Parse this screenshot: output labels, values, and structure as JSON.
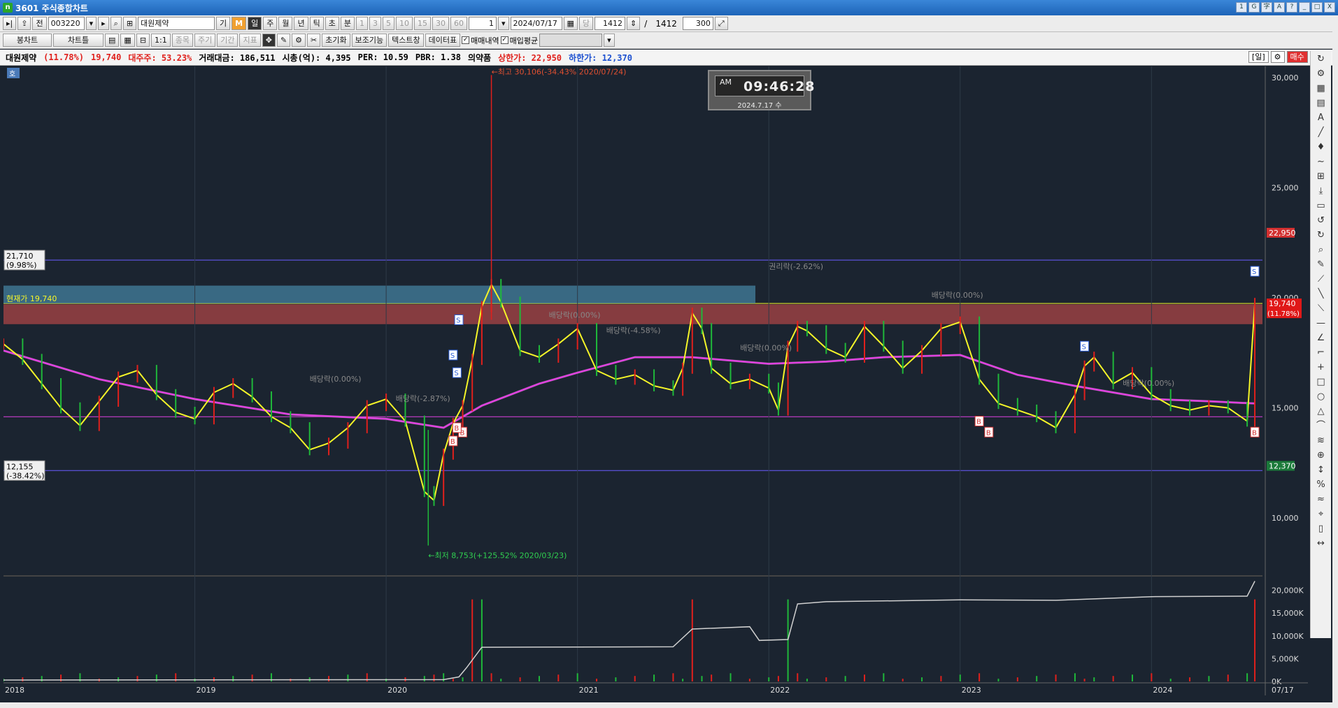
{
  "window": {
    "app_logo": "n",
    "title": "3601 주식종합차트",
    "buttons": [
      "1",
      "G",
      "字",
      "A",
      "?",
      "_",
      "□",
      "X"
    ]
  },
  "toolbar1": {
    "icon_prev": "▸|",
    "btn_jeon": "전",
    "stock_code": "003220",
    "stock_name": "대원제약",
    "btn_gi": "기",
    "btn_m": "M",
    "periods": [
      "일",
      "주",
      "월",
      "년",
      "틱",
      "초",
      "분"
    ],
    "active_period": "일",
    "minute_options": [
      "1",
      "3",
      "5",
      "10",
      "15",
      "30",
      "60"
    ],
    "count_value": "1",
    "date_value": "2024/07/17",
    "btn_dang": "당",
    "view_count": "1412",
    "slash": "/",
    "total_count": "1412",
    "display_count": "300"
  },
  "toolbar2": {
    "chart_type": "봉차트",
    "chart_frame": "차트틀",
    "btn_item": "종목",
    "btn_period": "주기",
    "btn_range": "기간",
    "btn_indicator": "지표",
    "btn_reset": "초기화",
    "btn_aux": "보조기능",
    "btn_text": "텍스트창",
    "btn_data": "데이터표",
    "chk_trade": "매매내역",
    "chk_avg": "매입평균"
  },
  "infobar": {
    "name": "대원제약",
    "change_pct": "(11.78%)",
    "price": "19,740",
    "major_label": "대주주:",
    "major_value": "53.23%",
    "turnover_label": "거래대금:",
    "turnover_value": "186,511",
    "mcap_label": "시총(억):",
    "mcap_value": "4,395",
    "per_label": "PER:",
    "per_value": "10.59",
    "pbr_label": "PBR:",
    "pbr_value": "1.38",
    "sector": "의약품",
    "upper_label": "상한가:",
    "upper_value": "22,950",
    "lower_label": "하한가:",
    "lower_value": "12,370",
    "right_buttons": [
      "[일]",
      "⚙",
      "매수",
      "매도"
    ]
  },
  "clock": {
    "ampm": "AM",
    "time": "09:46:28",
    "date": "2024.7.17 수"
  },
  "colors": {
    "background": "#1b2430",
    "up": "#e0201c",
    "down": "#1fb83a",
    "ma_yellow": "#f5f528",
    "ma_magenta": "#e040e0",
    "ma_gray": "#8a8a8a",
    "volume_line": "#d0d0d0"
  },
  "chart_data": {
    "type": "line",
    "price_axis": {
      "ticks": [
        "30,000",
        "25,000",
        "20,000",
        "15,000",
        "10,000"
      ],
      "min": 7500,
      "max": 30500
    },
    "volume_axis": {
      "ticks": [
        "20,000K",
        "15,000K",
        "10,000K",
        "5,000K",
        "0K"
      ],
      "max": 23000000
    },
    "x_labels": [
      "2018",
      "2019",
      "2020",
      "2021",
      "2022",
      "2023",
      "2024",
      "07/17"
    ],
    "price_labels": {
      "upper_limit": "22,950",
      "current": "19,740",
      "current_pct": "(11.78%)",
      "lower_limit": "12,370"
    },
    "left_labels": {
      "high_line": "21,710",
      "high_pct": "(9.98%)",
      "current_line": "현재가 19,740",
      "low_line": "12,155",
      "low_pct": "(-38.42%)"
    },
    "annotations": {
      "max_label": "←최고 30,106(-34.43% 2020/07/24)",
      "min_label": "←최저 8,753(+125.52% 2020/03/23)",
      "rights_label": "권리락(-2.62%)",
      "dividend1": "배당락(0.00%)",
      "dividend2": "배당락(0.00%)",
      "dividend3": "배당락(0.00%)",
      "dividend4": "배당락(0.00%)",
      "dividend5": "배당락(0.00%)",
      "dividend6": "배당락(-2.87%)",
      "dividend7": "배당락(-4.58%)",
      "ho": "호"
    },
    "series": [
      {
        "name": "",
        "values": [
          [
            2018.0,
            17900
          ],
          [
            2018.1,
            17200
          ],
          [
            2018.2,
            16100
          ],
          [
            2018.3,
            15000
          ],
          [
            2018.4,
            14200
          ],
          [
            2018.5,
            15300
          ],
          [
            2018.6,
            16400
          ],
          [
            2018.7,
            16700
          ],
          [
            2018.8,
            15600
          ],
          [
            2018.9,
            14800
          ],
          [
            2019.0,
            14500
          ],
          [
            2019.1,
            15700
          ],
          [
            2019.2,
            16100
          ],
          [
            2019.3,
            15500
          ],
          [
            2019.4,
            14600
          ],
          [
            2019.5,
            14100
          ],
          [
            2019.6,
            13100
          ],
          [
            2019.7,
            13400
          ],
          [
            2019.8,
            14100
          ],
          [
            2019.9,
            15100
          ],
          [
            2020.0,
            15400
          ],
          [
            2020.1,
            14400
          ],
          [
            2020.2,
            11200
          ],
          [
            2020.25,
            10800
          ],
          [
            2020.3,
            12900
          ],
          [
            2020.35,
            14300
          ],
          [
            2020.4,
            15100
          ],
          [
            2020.45,
            17200
          ],
          [
            2020.5,
            19600
          ],
          [
            2020.55,
            20600
          ],
          [
            2020.6,
            19800
          ],
          [
            2020.7,
            17600
          ],
          [
            2020.8,
            17300
          ],
          [
            2020.9,
            17900
          ],
          [
            2021.0,
            18600
          ],
          [
            2021.1,
            16700
          ],
          [
            2021.2,
            16300
          ],
          [
            2021.3,
            16500
          ],
          [
            2021.4,
            16000
          ],
          [
            2021.5,
            15800
          ],
          [
            2021.55,
            16800
          ],
          [
            2021.6,
            19300
          ],
          [
            2021.65,
            18600
          ],
          [
            2021.7,
            16800
          ],
          [
            2021.8,
            16100
          ],
          [
            2021.9,
            16300
          ],
          [
            2022.0,
            15900
          ],
          [
            2022.05,
            14900
          ],
          [
            2022.1,
            17800
          ],
          [
            2022.15,
            18700
          ],
          [
            2022.2,
            18500
          ],
          [
            2022.3,
            17700
          ],
          [
            2022.4,
            17300
          ],
          [
            2022.5,
            18700
          ],
          [
            2022.6,
            17800
          ],
          [
            2022.7,
            16800
          ],
          [
            2022.8,
            17600
          ],
          [
            2022.9,
            18600
          ],
          [
            2023.0,
            18900
          ],
          [
            2023.1,
            16300
          ],
          [
            2023.2,
            15200
          ],
          [
            2023.3,
            14900
          ],
          [
            2023.4,
            14600
          ],
          [
            2023.5,
            14100
          ],
          [
            2023.6,
            15600
          ],
          [
            2023.65,
            16900
          ],
          [
            2023.7,
            17300
          ],
          [
            2023.8,
            16100
          ],
          [
            2023.9,
            16600
          ],
          [
            2024.0,
            15600
          ],
          [
            2024.1,
            15100
          ],
          [
            2024.2,
            14900
          ],
          [
            2024.3,
            15100
          ],
          [
            2024.4,
            15000
          ],
          [
            2024.5,
            14400
          ],
          [
            2024.54,
            19740
          ]
        ]
      },
      {
        "name": "",
        "values": [
          [
            2018.0,
            17600
          ],
          [
            2018.5,
            16300
          ],
          [
            2019.0,
            15400
          ],
          [
            2019.5,
            14700
          ],
          [
            2020.0,
            14500
          ],
          [
            2020.3,
            14100
          ],
          [
            2020.5,
            15100
          ],
          [
            2020.8,
            16100
          ],
          [
            2021.0,
            16600
          ],
          [
            2021.3,
            17300
          ],
          [
            2021.6,
            17300
          ],
          [
            2022.0,
            17000
          ],
          [
            2022.3,
            17100
          ],
          [
            2022.6,
            17300
          ],
          [
            2023.0,
            17400
          ],
          [
            2023.3,
            16500
          ],
          [
            2023.6,
            16000
          ],
          [
            2024.0,
            15400
          ],
          [
            2024.3,
            15300
          ],
          [
            2024.54,
            15200
          ]
        ]
      }
    ],
    "volume_line": [
      [
        2018.0,
        300000
      ],
      [
        2020.3,
        400000
      ],
      [
        2020.38,
        1000000
      ],
      [
        2020.42,
        3000000
      ],
      [
        2020.5,
        7500000
      ],
      [
        2021.5,
        7600000
      ],
      [
        2021.6,
        11500000
      ],
      [
        2021.9,
        12000000
      ],
      [
        2021.95,
        9000000
      ],
      [
        2022.1,
        9200000
      ],
      [
        2022.15,
        17000000
      ],
      [
        2022.3,
        17500000
      ],
      [
        2023.0,
        17900000
      ],
      [
        2023.5,
        17800000
      ],
      [
        2024.0,
        18600000
      ],
      [
        2024.5,
        18700000
      ],
      [
        2024.54,
        22000000
      ]
    ]
  },
  "side_tools": [
    "↻",
    "⚙",
    "▦",
    "▤",
    "A",
    "╱",
    "♦",
    "∼",
    "⊞",
    "⤓",
    "▭",
    "↺",
    "↻",
    "⌕",
    "✎",
    "⟋",
    "╲",
    "⟍",
    "—",
    "∠",
    "⌐",
    "+",
    "□",
    "○",
    "△",
    "⌒",
    "≋",
    "⊕",
    "↕",
    "%",
    "≈",
    "⌖",
    "▯",
    "↔"
  ]
}
